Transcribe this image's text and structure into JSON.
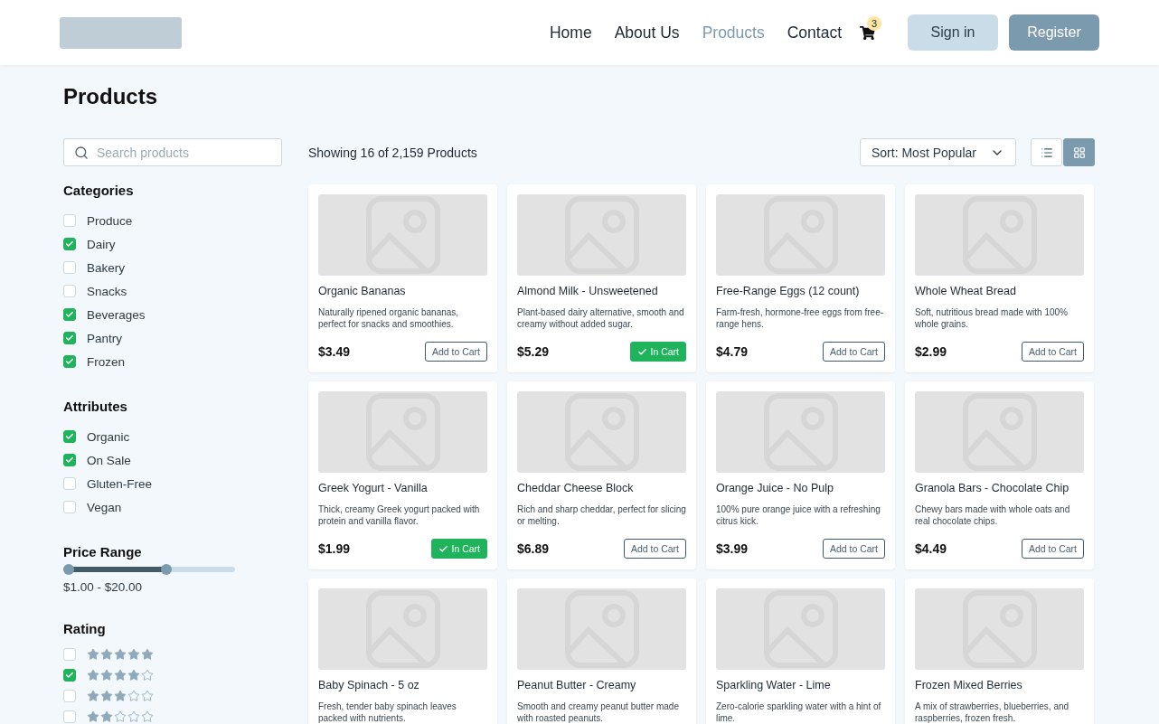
{
  "header": {
    "nav": [
      {
        "label": "Home",
        "selected": false
      },
      {
        "label": "About Us",
        "selected": false
      },
      {
        "label": "Products",
        "selected": true
      },
      {
        "label": "Contact",
        "selected": false
      }
    ],
    "cart_count": "3",
    "buttons": [
      {
        "label": "Sign in",
        "kind": "secondary"
      },
      {
        "label": "Register",
        "kind": "primary"
      }
    ]
  },
  "title": "Products",
  "search": {
    "placeholder": "Search products"
  },
  "filters": {
    "categories": {
      "title": "Categories",
      "items": [
        {
          "label": "Produce",
          "checked": false
        },
        {
          "label": "Dairy",
          "checked": true
        },
        {
          "label": "Bakery",
          "checked": false
        },
        {
          "label": "Snacks",
          "checked": false
        },
        {
          "label": "Beverages",
          "checked": true
        },
        {
          "label": "Pantry",
          "checked": true
        },
        {
          "label": "Frozen",
          "checked": true
        }
      ]
    },
    "attributes": {
      "title": "Attributes",
      "items": [
        {
          "label": "Organic",
          "checked": true
        },
        {
          "label": "On Sale",
          "checked": true
        },
        {
          "label": "Gluten-Free",
          "checked": false
        },
        {
          "label": "Vegan",
          "checked": false
        }
      ]
    },
    "price": {
      "title": "Price Range",
      "thumbs": [
        {
          "level": 0.03
        },
        {
          "level": 0.6
        }
      ],
      "reading": "$1.00 - $20.00"
    },
    "rating": {
      "title": "Rating",
      "items": [
        {
          "stars": 5,
          "checked": false
        },
        {
          "stars": 4,
          "checked": true
        },
        {
          "stars": 3,
          "checked": false
        },
        {
          "stars": 2,
          "checked": false
        }
      ]
    }
  },
  "results": "Showing 16 of 2,159 Products",
  "sort": "Sort: Most Popular",
  "views": [
    {
      "kind": "list",
      "selected": false
    },
    {
      "kind": "grid",
      "selected": true
    }
  ],
  "products": [
    {
      "name": "Organic Bananas",
      "description": "Naturally ripened organic bananas, perfect for snacks and smoothies.",
      "price": "$3.49",
      "in_cart": false,
      "button": "Add to Cart"
    },
    {
      "name": "Almond Milk - Unsweetened",
      "description": "Plant-based dairy alternative, smooth and creamy without added sugar.",
      "price": "$5.29",
      "in_cart": true,
      "button": "In Cart"
    },
    {
      "name": "Free-Range Eggs (12 count)",
      "description": "Farm-fresh, hormone-free eggs from free-range hens.",
      "price": "$4.79",
      "in_cart": false,
      "button": "Add to Cart"
    },
    {
      "name": "Whole Wheat Bread",
      "description": "Soft, nutritious bread made with 100% whole grains.",
      "price": "$2.99",
      "in_cart": false,
      "button": "Add to Cart"
    },
    {
      "name": "Greek Yogurt - Vanilla",
      "description": "Thick, creamy Greek yogurt packed with protein and vanilla flavor.",
      "price": "$1.99",
      "in_cart": true,
      "button": "In Cart"
    },
    {
      "name": "Cheddar Cheese Block",
      "description": "Rich and sharp cheddar, perfect for slicing or melting.",
      "price": "$6.89",
      "in_cart": false,
      "button": "Add to Cart"
    },
    {
      "name": "Orange Juice - No Pulp",
      "description": "100% pure orange juice with a refreshing citrus kick.",
      "price": "$3.99",
      "in_cart": false,
      "button": "Add to Cart"
    },
    {
      "name": "Granola Bars - Chocolate Chip",
      "description": "Chewy bars made with whole oats and real chocolate chips.",
      "price": "$4.49",
      "in_cart": false,
      "button": "Add to Cart"
    },
    {
      "name": "Baby Spinach - 5 oz",
      "description": "Fresh, tender baby spinach leaves packed with nutrients."
    },
    {
      "name": "Peanut Butter - Creamy",
      "description": "Smooth and creamy peanut butter made with roasted peanuts."
    },
    {
      "name": "Sparkling Water - Lime",
      "description": "Zero-calorie sparkling water with a hint of lime."
    },
    {
      "name": "Frozen Mixed Berries",
      "description": "A mix of strawberries, blueberries, and raspberries, frozen fresh."
    }
  ]
}
